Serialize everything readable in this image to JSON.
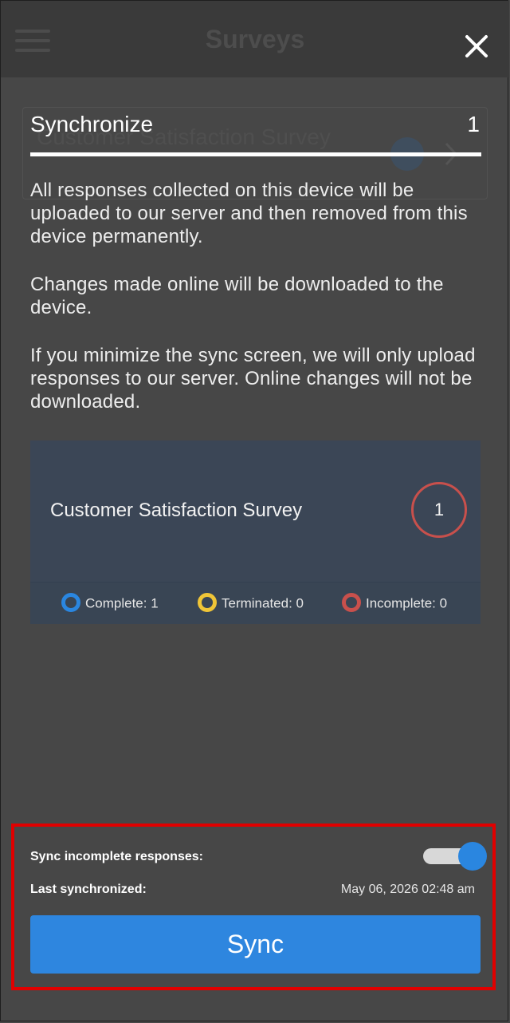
{
  "app": {
    "title": "Surveys"
  },
  "background_card": {
    "title": "Customer Satisfaction Survey"
  },
  "sync": {
    "title": "Synchronize",
    "count": "1",
    "paragraphs": [
      "All responses collected on this device will be uploaded to our server and then removed from this device permanently.",
      "Changes made online will be downloaded to the device.",
      "If you minimize the sync screen, we will only upload responses to our server. Online changes will not be downloaded."
    ],
    "survey": {
      "name": "Customer Satisfaction Survey",
      "count": "1",
      "legend": [
        {
          "label": "Complete: 1",
          "color": "#2a86e0"
        },
        {
          "label": "Terminated: 0",
          "color": "#f0c537"
        },
        {
          "label": "Incomplete: 0",
          "color": "#c8504c"
        }
      ]
    },
    "options": {
      "sync_incomplete_label": "Sync incomplete responses:",
      "sync_incomplete_enabled": true,
      "last_synchronized_label": "Last synchronized:",
      "last_synchronized_value": "May 06, 2026 02:48 am"
    },
    "button_label": "Sync"
  },
  "icons": {
    "close": "close-icon",
    "menu": "hamburger-icon",
    "chevron": "chevron-right-icon"
  },
  "colors": {
    "accent": "#2e86df",
    "highlight_border": "#e00000",
    "overlay": "#474747",
    "survey_panel": "#3b4656"
  }
}
